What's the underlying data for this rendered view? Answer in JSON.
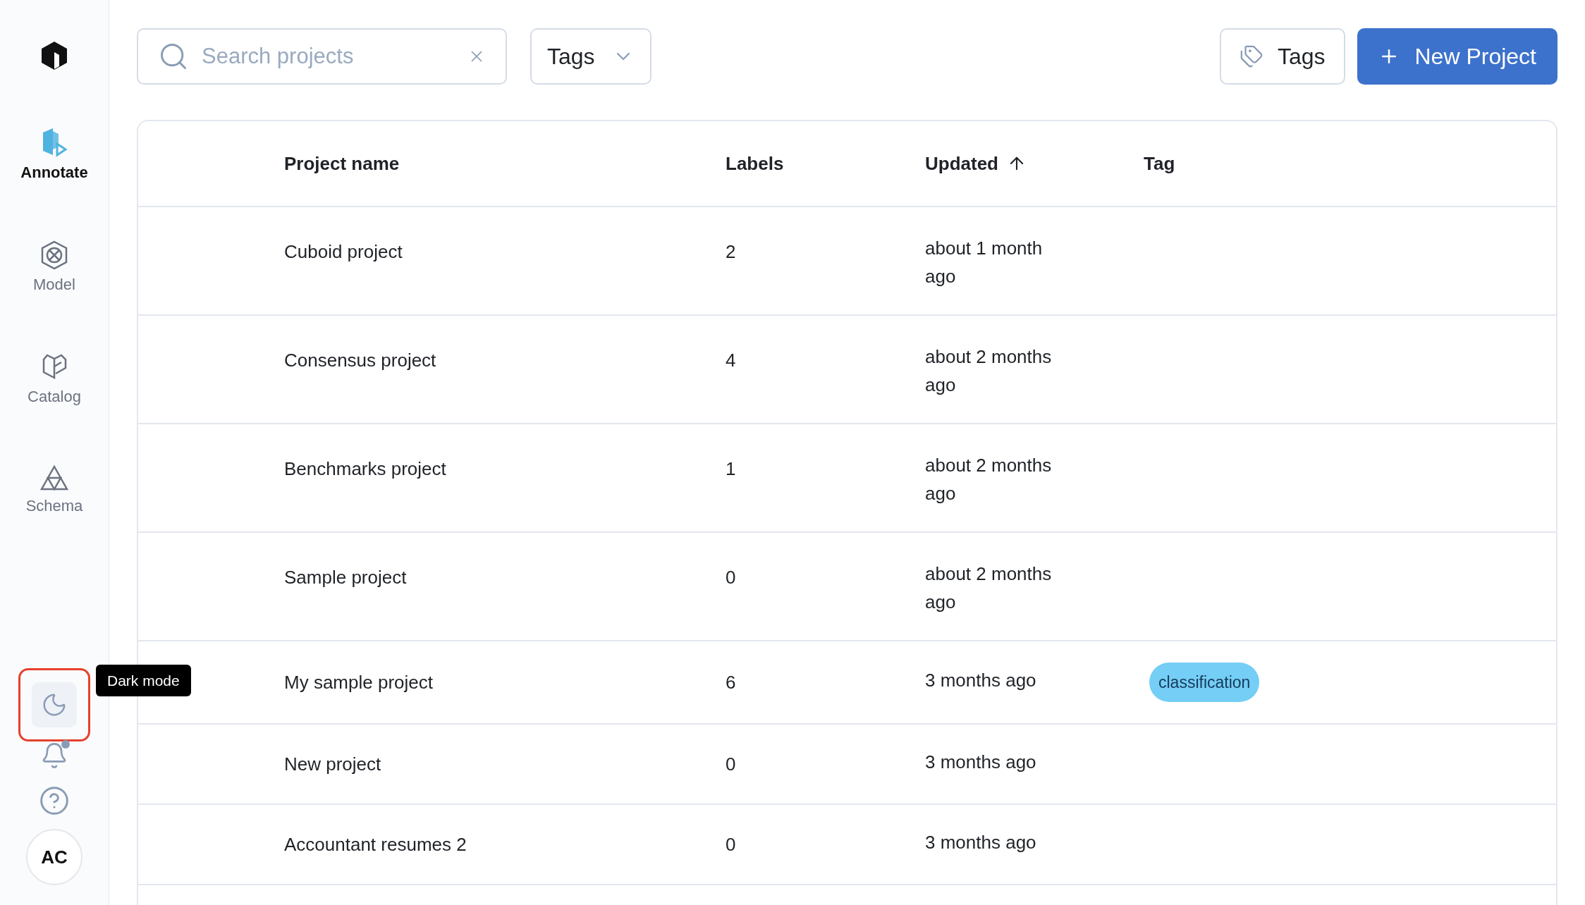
{
  "sidebar": {
    "items": [
      {
        "label": "Annotate",
        "kind": "annotate",
        "selected": true
      },
      {
        "label": "Model",
        "kind": "model",
        "selected": false
      },
      {
        "label": "Catalog",
        "kind": "catalog",
        "selected": false
      },
      {
        "label": "Schema",
        "kind": "schema",
        "selected": false
      }
    ],
    "dark_mode_button": {
      "highlighted": true,
      "tooltip": "Dark mode"
    },
    "notifications": {
      "unread": true
    },
    "avatar": "AC"
  },
  "toolbar": {
    "search": {
      "placeholder": "Search projects"
    },
    "tags_filter": "Tags",
    "tags_button": "Tags",
    "new_project_button": "New Project"
  },
  "table": {
    "columns": [
      {
        "label": "Project name",
        "sorted": false
      },
      {
        "label": "Labels",
        "sorted": false
      },
      {
        "label": "Updated",
        "sorted": true
      },
      {
        "label": "Tag",
        "sorted": false
      }
    ],
    "rows": [
      {
        "name": "Cuboid project",
        "labels": "2",
        "updated": "about 1 month ago"
      },
      {
        "name": "Consensus project",
        "labels": "4",
        "updated": "about 2 months ago"
      },
      {
        "name": "Benchmarks project",
        "labels": "1",
        "updated": "about 2 months ago"
      },
      {
        "name": "Sample project",
        "labels": "0",
        "updated": "about 2 months ago"
      },
      {
        "name": "My sample project",
        "labels": "6",
        "updated": "3 months ago",
        "tags": [
          {
            "label": "classification",
            "color": "#74cef5"
          }
        ]
      },
      {
        "name": "New project",
        "labels": "0",
        "updated": "3 months ago"
      },
      {
        "name": "Accountant resumes 2",
        "labels": "0",
        "updated": "3 months ago"
      }
    ]
  }
}
